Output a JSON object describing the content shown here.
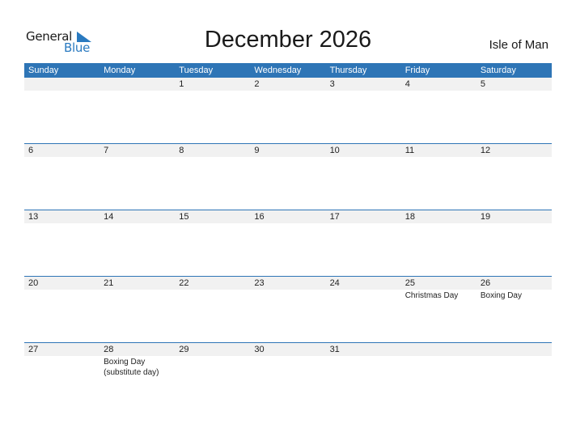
{
  "logo": {
    "word1": "General",
    "word2": "Blue"
  },
  "title": "December 2026",
  "country": "Isle of Man",
  "colors": {
    "accent": "#2e75b6",
    "day_bar": "#f1f1f1"
  },
  "weekdays": [
    "Sunday",
    "Monday",
    "Tuesday",
    "Wednesday",
    "Thursday",
    "Friday",
    "Saturday"
  ],
  "weeks": [
    [
      {
        "day": "",
        "holiday": ""
      },
      {
        "day": "",
        "holiday": ""
      },
      {
        "day": "1",
        "holiday": ""
      },
      {
        "day": "2",
        "holiday": ""
      },
      {
        "day": "3",
        "holiday": ""
      },
      {
        "day": "4",
        "holiday": ""
      },
      {
        "day": "5",
        "holiday": ""
      }
    ],
    [
      {
        "day": "6",
        "holiday": ""
      },
      {
        "day": "7",
        "holiday": ""
      },
      {
        "day": "8",
        "holiday": ""
      },
      {
        "day": "9",
        "holiday": ""
      },
      {
        "day": "10",
        "holiday": ""
      },
      {
        "day": "11",
        "holiday": ""
      },
      {
        "day": "12",
        "holiday": ""
      }
    ],
    [
      {
        "day": "13",
        "holiday": ""
      },
      {
        "day": "14",
        "holiday": ""
      },
      {
        "day": "15",
        "holiday": ""
      },
      {
        "day": "16",
        "holiday": ""
      },
      {
        "day": "17",
        "holiday": ""
      },
      {
        "day": "18",
        "holiday": ""
      },
      {
        "day": "19",
        "holiday": ""
      }
    ],
    [
      {
        "day": "20",
        "holiday": ""
      },
      {
        "day": "21",
        "holiday": ""
      },
      {
        "day": "22",
        "holiday": ""
      },
      {
        "day": "23",
        "holiday": ""
      },
      {
        "day": "24",
        "holiday": ""
      },
      {
        "day": "25",
        "holiday": "Christmas Day"
      },
      {
        "day": "26",
        "holiday": "Boxing Day"
      }
    ],
    [
      {
        "day": "27",
        "holiday": ""
      },
      {
        "day": "28",
        "holiday": "Boxing Day (substitute day)"
      },
      {
        "day": "29",
        "holiday": ""
      },
      {
        "day": "30",
        "holiday": ""
      },
      {
        "day": "31",
        "holiday": ""
      },
      {
        "day": "",
        "holiday": ""
      },
      {
        "day": "",
        "holiday": ""
      }
    ]
  ]
}
